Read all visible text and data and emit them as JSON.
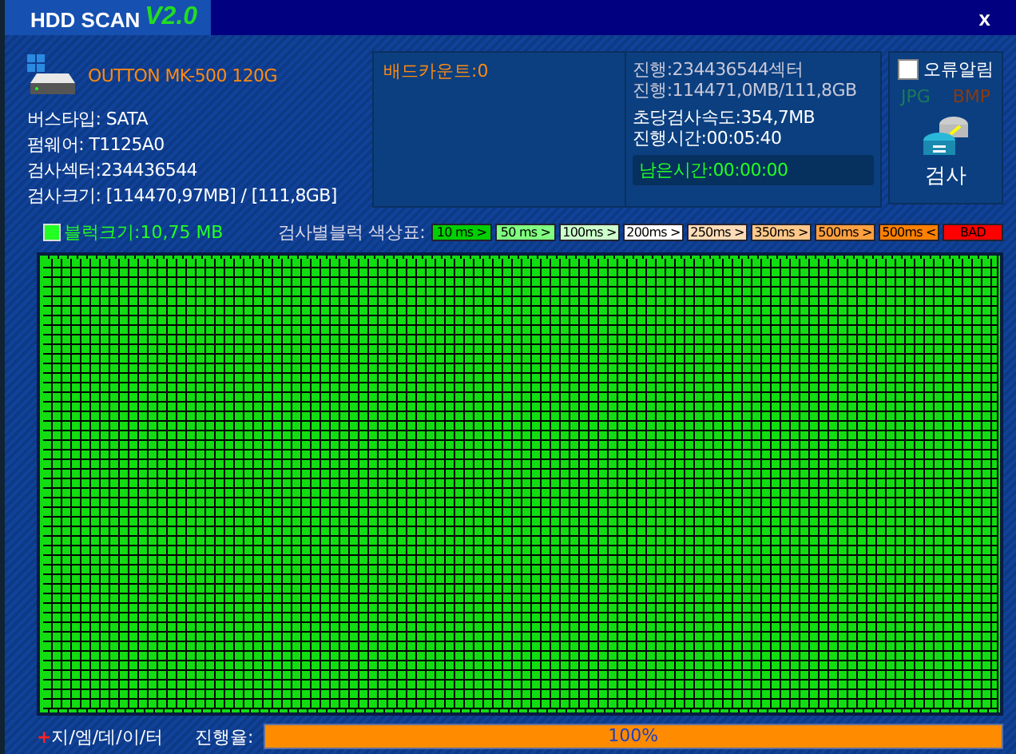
{
  "window": {
    "title": "HDD SCAN",
    "version": "V2.0",
    "close": "x"
  },
  "drive": {
    "name": "OUTTON MK-500 120G",
    "bus_type": "버스타입: SATA",
    "firmware": "펌웨어: T1125A0",
    "sectors": "검사섹터:234436544",
    "size": "검사크기: [114470,97MB] / [111,8GB]"
  },
  "bad_count": "배드카운트:0",
  "progress_info": {
    "sectors": "진행:234436544섹터",
    "bytes": "진행:114471,0MB/111,8GB",
    "speed": "초당검사속도:354,7MB",
    "elapsed": "진행시간:00:05:40",
    "remaining": "남은시간:00:00:00"
  },
  "options": {
    "error_alert": {
      "label": "오류알림",
      "checked": false
    },
    "formats": [
      {
        "label": "JPG",
        "color": "#1a7a5a"
      },
      {
        "label": "BMP",
        "color": "#8a3a10"
      }
    ],
    "scan_button": "검사"
  },
  "block_size": "블럭크기:10,75 MB",
  "legend": {
    "title": "검사별블럭 색상표:",
    "items": [
      {
        "label": "10 ms >",
        "color": "#00d000"
      },
      {
        "label": "50 ms >",
        "color": "#80ff80"
      },
      {
        "label": "100ms >",
        "color": "#ccffcc"
      },
      {
        "label": "200ms >",
        "color": "#ffffff"
      },
      {
        "label": "250ms >",
        "color": "#ffdcb8"
      },
      {
        "label": "350ms >",
        "color": "#ffc88a"
      },
      {
        "label": "500ms >",
        "color": "#ffa040"
      },
      {
        "label": "500ms <",
        "color": "#ff8000"
      },
      {
        "label": "BAD",
        "color": "#ff0000"
      }
    ]
  },
  "footer": {
    "brand_mark": "+",
    "brand": "지/엠/데/이/터",
    "progress_label": "진행율:",
    "progress": {
      "level": 1,
      "text": "100%"
    }
  }
}
